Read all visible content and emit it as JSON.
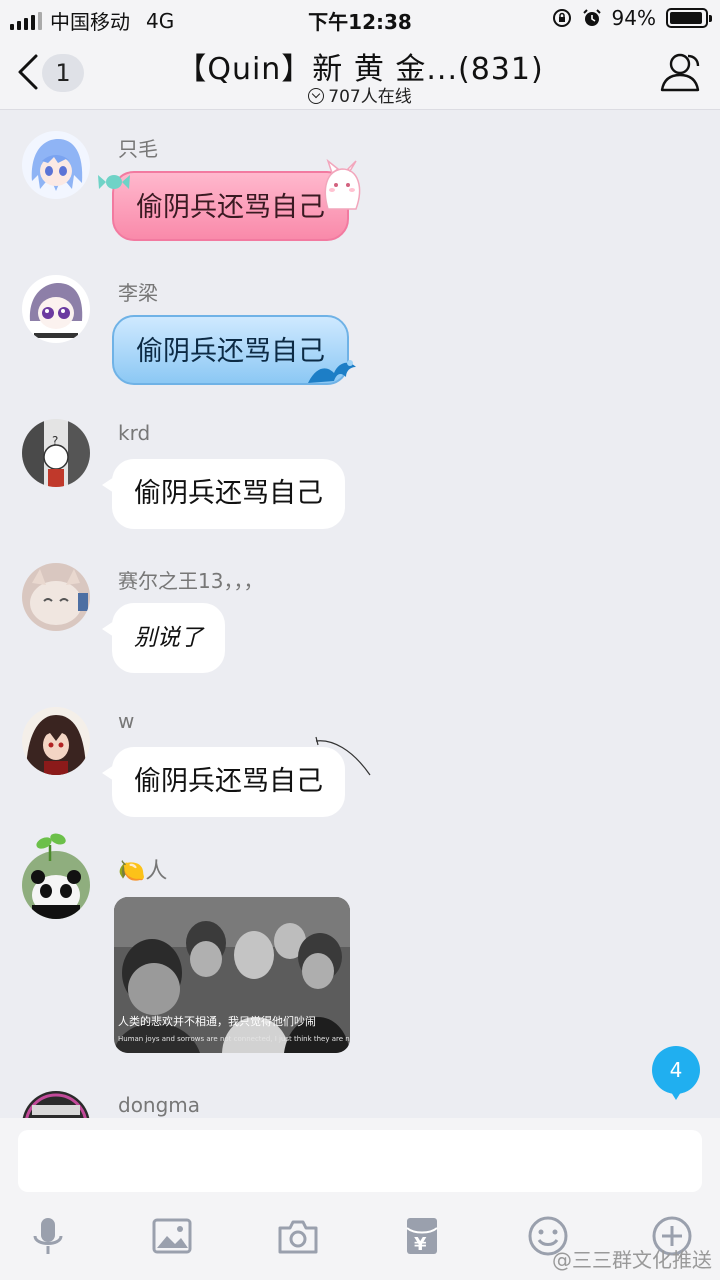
{
  "status_bar": {
    "carrier": "中国移动",
    "network": "4G",
    "time": "下午12:38",
    "battery": "94%",
    "battery_level": 0.94
  },
  "header": {
    "unread_count": "1",
    "title": "【Quin】新 黄 金...(831)",
    "online": "707人在线"
  },
  "messages": [
    {
      "name": "只毛",
      "text": "偷阴兵还骂自己",
      "bubble_style": "pink"
    },
    {
      "name": "李梁",
      "text": "偷阴兵还骂自己",
      "bubble_style": "blue"
    },
    {
      "name": "krd",
      "text": "偷阴兵还骂自己",
      "bubble_style": "plain"
    },
    {
      "name": "赛尔之王13，，，",
      "text": "别说了",
      "bubble_style": "handwritten"
    },
    {
      "name": "w",
      "text": "偷阴兵还骂自己",
      "bubble_style": "plain"
    },
    {
      "name": "🍋人",
      "image_caption": "人类的悲欢并不相通，我只觉得他们吵闹",
      "image_caption_en": "Human joys and sorrows are not connected, I just think they are noisy."
    },
    {
      "name": "dongma"
    }
  ],
  "new_messages_badge": "4",
  "input": {
    "placeholder": "",
    "value": ""
  },
  "toolbar": {
    "icons": [
      "microphone-icon",
      "image-icon",
      "camera-icon",
      "red-packet-icon",
      "emoji-icon",
      "plus-icon"
    ]
  },
  "watermark": "@三三群文化推送",
  "colors": {
    "accent": "#20aff0",
    "pink_bubble": "#f98aaa",
    "blue_bubble": "#8cc8f4"
  }
}
